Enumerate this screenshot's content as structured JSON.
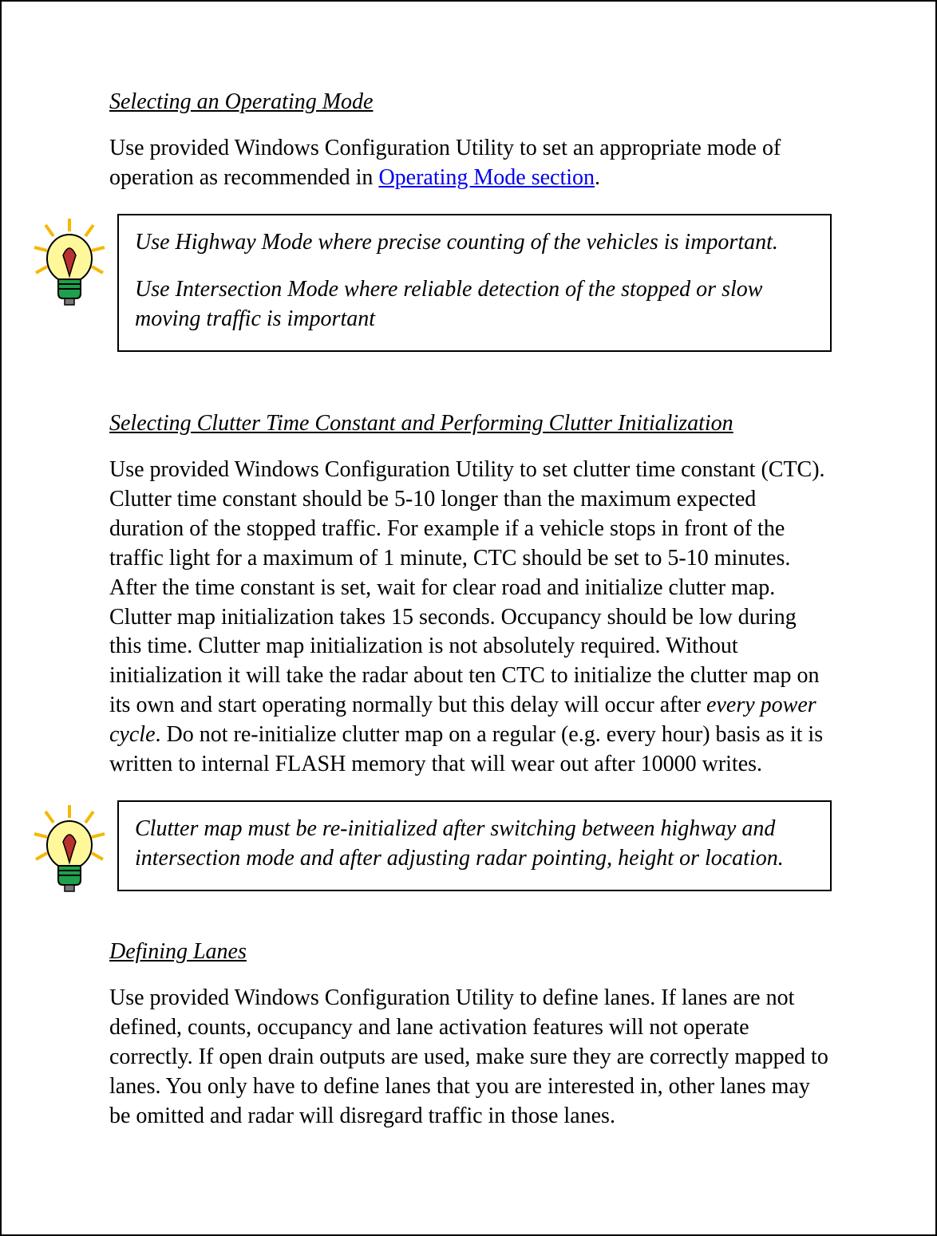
{
  "section1": {
    "heading": "Selecting an Operating Mode",
    "para_before_link": "Use provided Windows Configuration Utility to set an appropriate mode of operation as recommended in ",
    "link_text": "Operating Mode section",
    "para_after_link": ".",
    "callout_p1": "Use Highway Mode where precise counting of the vehicles is important.",
    "callout_p2": "Use Intersection Mode where reliable detection of the stopped or slow moving traffic is important"
  },
  "section2": {
    "heading": "Selecting Clutter Time Constant and Performing Clutter Initialization",
    "para_before_emph": "Use provided Windows Configuration Utility to set clutter time constant (CTC). Clutter time constant should be 5-10 longer than the maximum expected duration of the stopped traffic. For example if a vehicle stops in front of the traffic light for a maximum of 1 minute, CTC should be set to 5-10 minutes. After the time constant is set, wait for clear road and initialize clutter map. Clutter map initialization takes 15 seconds. Occupancy should be low during this time. Clutter map initialization is not absolutely required. Without initialization it will take the radar about ten CTC to initialize the clutter map on its own and start operating normally but this delay will occur after ",
    "emph_text": "every power cycle",
    "para_after_emph": ". Do not re-initialize clutter map on a regular (e.g. every hour) basis as it is written to internal FLASH memory that will wear out after 10000 writes.",
    "callout_p1": "Clutter map must be re-initialized after switching between highway and intersection mode and after adjusting radar pointing, height or location."
  },
  "section3": {
    "heading": "Defining Lanes",
    "para": "Use provided Windows Configuration Utility to define lanes. If lanes are not defined, counts, occupancy and lane activation features will not operate correctly. If open drain outputs are used, make sure they are correctly mapped to lanes. You only have to define lanes that you are interested in, other lanes may be omitted and radar will disregard traffic in those lanes."
  }
}
